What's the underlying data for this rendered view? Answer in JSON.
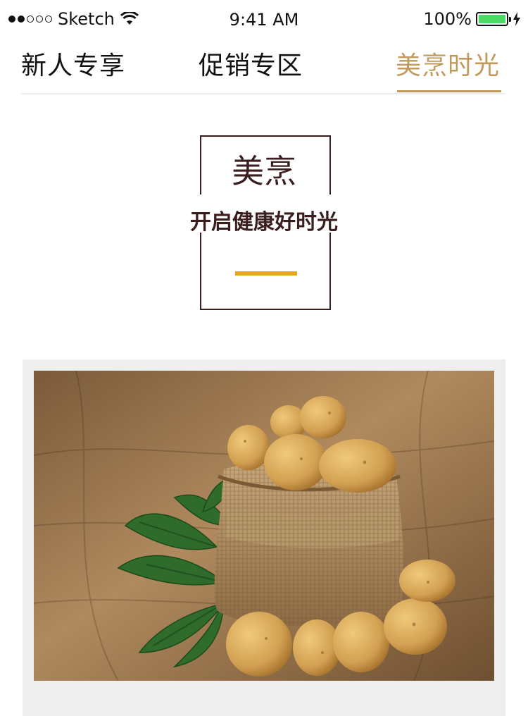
{
  "status_bar": {
    "carrier": "Sketch",
    "time": "9:41 AM",
    "battery": "100%",
    "signal_strength": 2,
    "signal_total": 5,
    "battery_fill_fraction": 1.0,
    "battery_color": "#4cd964",
    "icons": [
      "wifi-icon",
      "battery-icon",
      "charging-icon"
    ]
  },
  "tabs": [
    {
      "label": "新人专享",
      "active": false
    },
    {
      "label": "促销专区",
      "active": false
    },
    {
      "label": "美烹时光",
      "active": true
    }
  ],
  "colors": {
    "accent": "#c09a5b",
    "heading": "#3a1e1e",
    "divider_bar": "#e5a91c",
    "card_bg": "#efefef"
  },
  "section": {
    "title": "美烹",
    "subtitle": "开启健康好时光"
  }
}
